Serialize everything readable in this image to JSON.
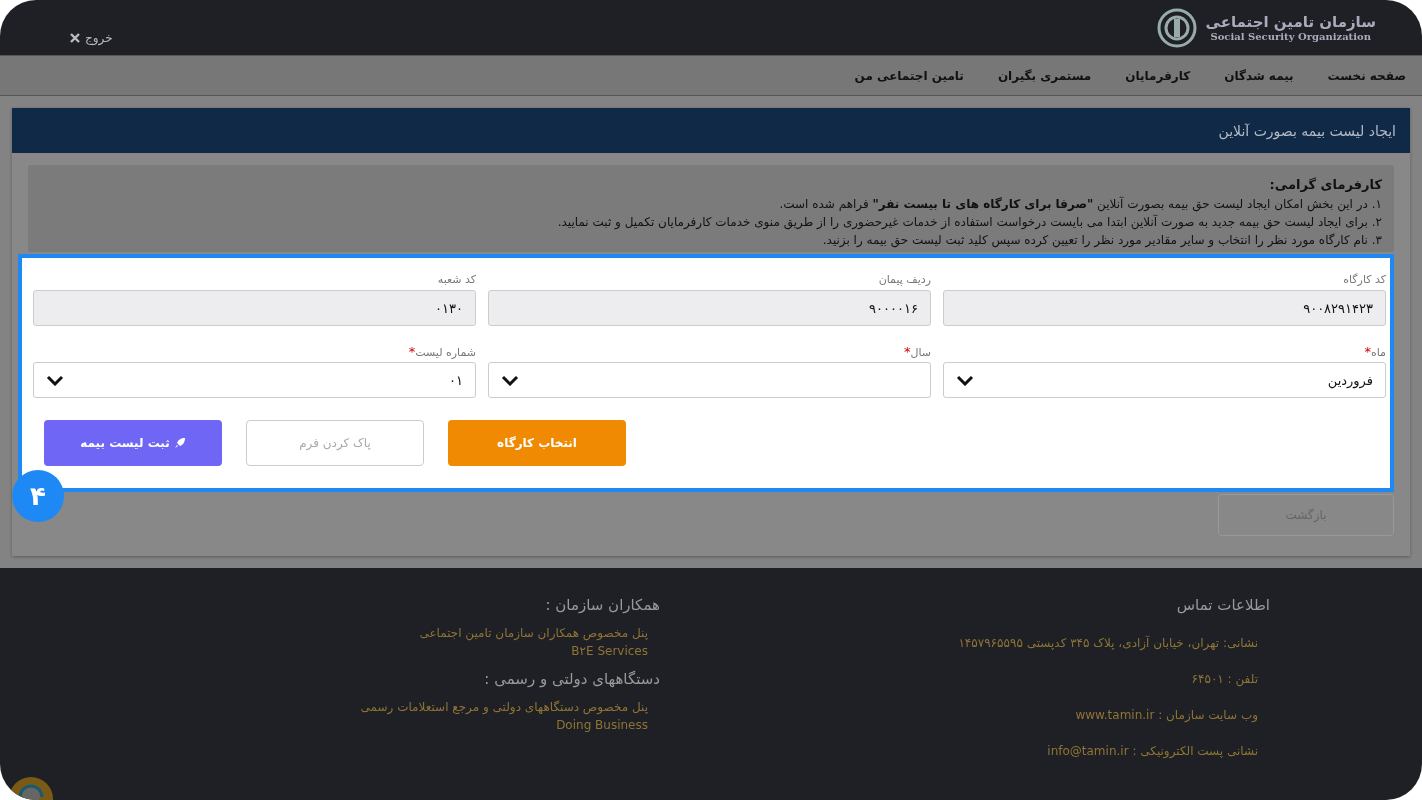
{
  "header": {
    "exit_link": "خروج",
    "logo_title": "سازمان تامین اجتماعی",
    "logo_subtitle": "Social Security Organization"
  },
  "nav": [
    "صفحه نخست",
    "بیمه شدگان",
    "کارفرمایان",
    "مستمری بگیران",
    "تامین اجتماعی من"
  ],
  "panel": {
    "title": "ایجاد لیست بیمه بصورت آنلاین"
  },
  "notice": {
    "heading": "کارفرمای گرامی:",
    "lines": [
      "۱. در این بخش امکان ایجاد لیست حق بیمه بصورت آنلاین **\"صرفا برای کارگاه های تا بیست نفر\"** فراهم شده است.",
      "۲. برای ایجاد لیست حق بیمه جدید به صورت آنلاین ابتدا می بایست درخواست استفاده از خدمات غیرحضوری را از طریق منوی خدمات کارفرمایان تکمیل و ثبت نمایید.",
      "۳. نام کارگاه مورد نظر را انتخاب و سایر مقادیر مورد نظر را تعیین کرده سپس کلید ثبت لیست حق بیمه را بزنید."
    ]
  },
  "form": {
    "step": "۴",
    "required_mark": "*",
    "fields": [
      {
        "kind": "readonly",
        "label": "کد کارگاه",
        "required": false,
        "value": "۹۰۰۸۲۹۱۴۲۳"
      },
      {
        "kind": "readonly",
        "label": "ردیف پیمان",
        "required": false,
        "value": "۹۰۰۰۰۱۶"
      },
      {
        "kind": "readonly",
        "label": "کد شعبه",
        "required": false,
        "value": "۰۱۳۰"
      },
      {
        "kind": "select",
        "label": "ماه",
        "required": true,
        "value": "فروردین"
      },
      {
        "kind": "select",
        "label": "سال",
        "required": true
      },
      {
        "kind": "select",
        "label": "شماره لیست",
        "required": true,
        "value": "۰۱"
      }
    ],
    "buttons": [
      {
        "kind": "orange",
        "label": "انتخاب کارگاه"
      },
      {
        "kind": "outline",
        "label": "پاک کردن فرم"
      },
      {
        "kind": "purple",
        "label": "ثبت لیست بیمه"
      }
    ]
  },
  "back_button": "بازگشت",
  "footer": {
    "contact": {
      "title": "اطلاعات تماس",
      "items": [
        "نشانی: تهران، خیابان آزادی، پلاک ۳۴۵ کدپستی ۱۴۵۷۹۶۵۵۹۵",
        "تلفن : ۶۴۵۰۱",
        "وب سایت سازمان : www.tamin.ir",
        "نشانی پست الکترونیکی : info@tamin.ir"
      ]
    },
    "partners": [
      {
        "title": "همکاران سازمان :",
        "links": [
          "پنل مخصوص همکاران سازمان تامین اجتماعی",
          "B۲E Services"
        ]
      },
      {
        "title": "دستگاههای دولتی و رسمی :",
        "links": [
          "پنل مخصوص دستگاههای دولتی و مرجع استعلامات رسمی",
          "Doing Business"
        ]
      }
    ]
  }
}
